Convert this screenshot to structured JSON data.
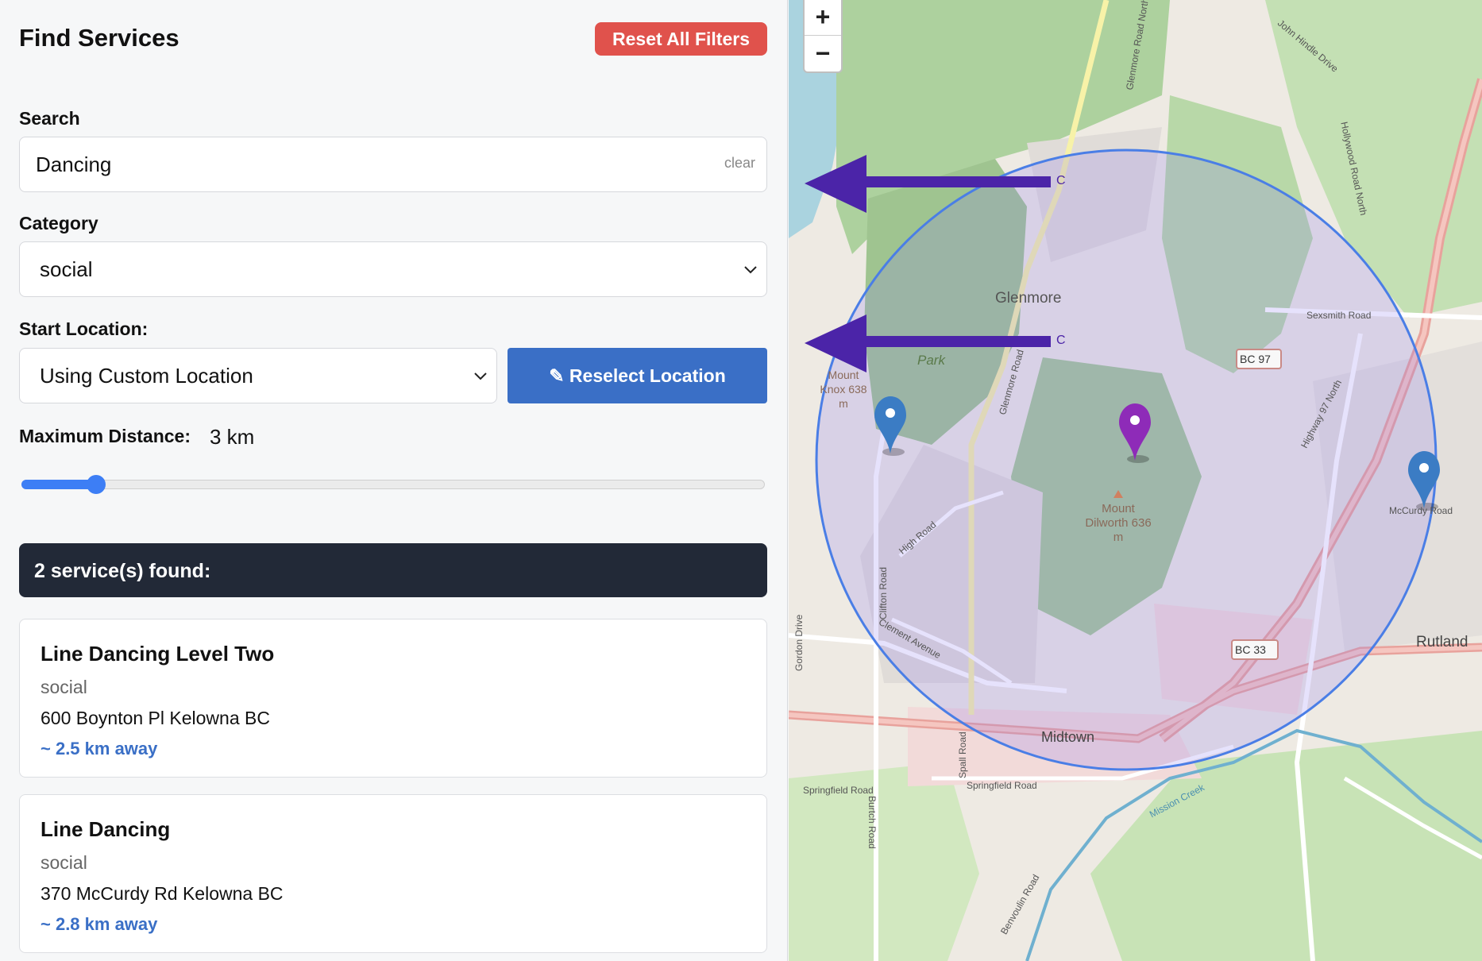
{
  "header": {
    "title": "Find Services",
    "reset_label": "Reset All Filters"
  },
  "search": {
    "label": "Search",
    "value": "Dancing",
    "clear_label": "clear"
  },
  "category": {
    "label": "Category",
    "selected": "social"
  },
  "start_location": {
    "label": "Start Location:",
    "selected": "Using Custom Location",
    "reselect_label": "✎ Reselect Location"
  },
  "distance": {
    "label": "Maximum Distance:",
    "value_label": "3 km",
    "value_km": 3,
    "slider_fraction": 0.1
  },
  "results": {
    "summary": "2 service(s) found:",
    "items": [
      {
        "title": "Line Dancing Level Two",
        "category": "social",
        "address": "600 Boynton Pl Kelowna BC",
        "distance": "~ 2.5 km away"
      },
      {
        "title": "Line Dancing",
        "category": "social",
        "address": "370 McCurdy Rd Kelowna BC",
        "distance": "~ 2.8 km away"
      }
    ]
  },
  "map": {
    "zoom_in": "+",
    "zoom_out": "−",
    "labels": {
      "glenmore": "Glenmore",
      "park": "Park",
      "mount_knox": "Mount Knox 638 m",
      "mount_dilworth": "Mount Dilworth 636 m",
      "midtown": "Midtown",
      "rutland": "Rutland",
      "sexsmith": "Sexsmith Road",
      "bc97": "BC 97",
      "bc33": "BC 33",
      "springfield": "Springfield Road",
      "mccurdy": "McCurdy Road",
      "highway97": "Highway 97 North",
      "high_road": "High Road",
      "clement": "Clement Avenue",
      "clifton": "Clifton Road",
      "gordon": "Gordon Drive",
      "glenmore_road": "Glenmore Road",
      "glenmore_road_north": "Glenmore Road North",
      "hollywood": "Hollywood Road North",
      "john_hindle": "John Hindle Drive",
      "spall": "Spall Road",
      "burtch": "Burtch Road",
      "benvoulin": "Benvoulin Road",
      "mission_creek": "Mission Creek",
      "marker_c": "C"
    },
    "colors": {
      "radius_circle": "#4a7ee6",
      "selected_marker": "#8e2bb8",
      "result_marker": "#3b7cc4",
      "arrow": "#4b24a8"
    }
  }
}
